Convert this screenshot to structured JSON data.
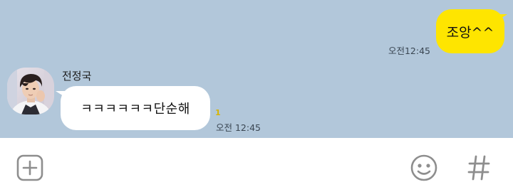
{
  "colors": {
    "chat_background": "#b2c7da",
    "outgoing_bubble": "#fee500",
    "incoming_bubble": "#ffffff",
    "unread_count": "#d7b400",
    "icon_gray": "#8e8e8e"
  },
  "messages": {
    "outgoing": {
      "text": "조앙^^",
      "time": "오전12:45"
    },
    "incoming": {
      "sender": "전정국",
      "text": "ㅋㅋㅋㅋㅋㅋ단순해",
      "unread": "1",
      "time": "오전 12:45"
    }
  },
  "input_bar": {
    "icons": [
      "plus-square-icon",
      "smiley-icon",
      "hashtag-icon"
    ]
  }
}
